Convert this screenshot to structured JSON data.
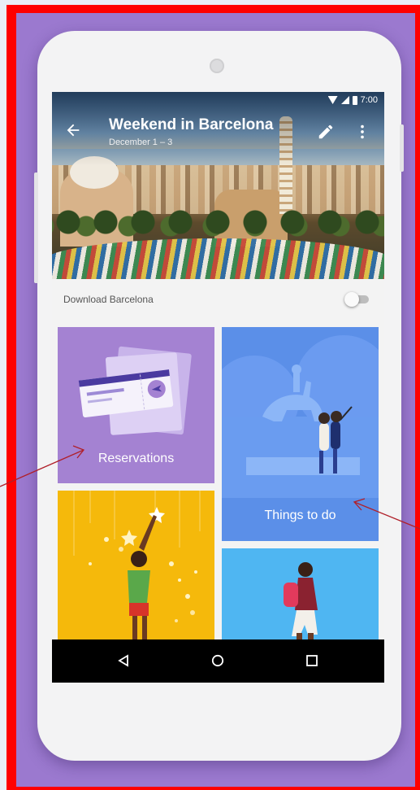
{
  "status_bar": {
    "time": "7:00"
  },
  "header": {
    "title": "Weekend in Barcelona",
    "dates": "December 1 – 3",
    "back_icon": "arrow-left-icon",
    "edit_icon": "pencil-icon",
    "more_icon": "more-vert-icon"
  },
  "download": {
    "label": "Download Barcelona",
    "enabled": false
  },
  "tiles": [
    {
      "label": "Reservations",
      "color": "#a482d2"
    },
    {
      "label": "Things to do",
      "color": "#5b8fe8"
    },
    {
      "label": "",
      "color": "#f5b90b"
    },
    {
      "label": "",
      "color": "#4fb6f2"
    }
  ],
  "nav": {
    "back_icon": "triangle-back-icon",
    "home_icon": "circle-home-icon",
    "recent_icon": "square-recents-icon"
  },
  "colors": {
    "background": "#9b79cf",
    "border": "#ff0000",
    "annotation_arrow": "#b0202a"
  }
}
